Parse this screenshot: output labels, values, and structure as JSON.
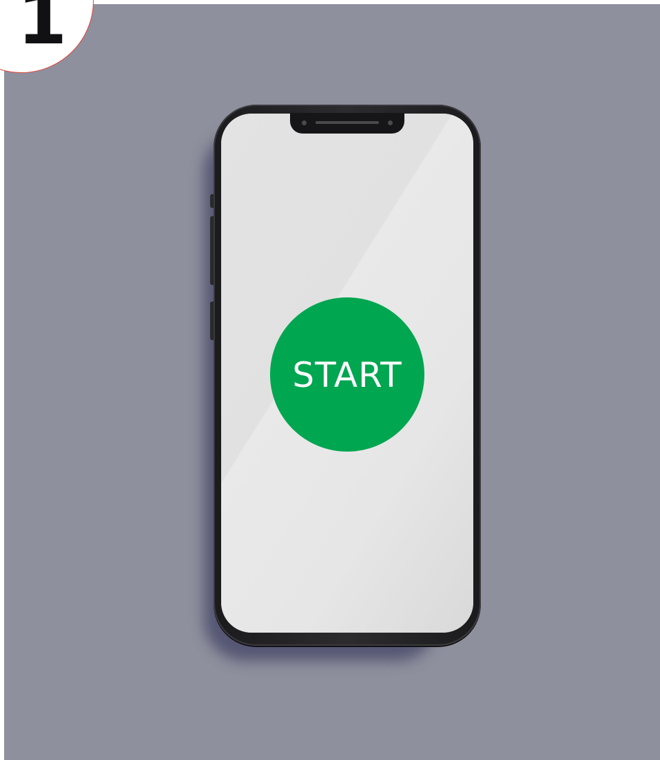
{
  "step_badge": {
    "number": "1"
  },
  "phone": {
    "start_button": {
      "label": "START",
      "color": "#00a650"
    }
  },
  "colors": {
    "panel_background": "#8f909d",
    "badge_border": "#e0463c",
    "screen": "#dcdcdc",
    "phone_frame": "#1b1b1d"
  }
}
